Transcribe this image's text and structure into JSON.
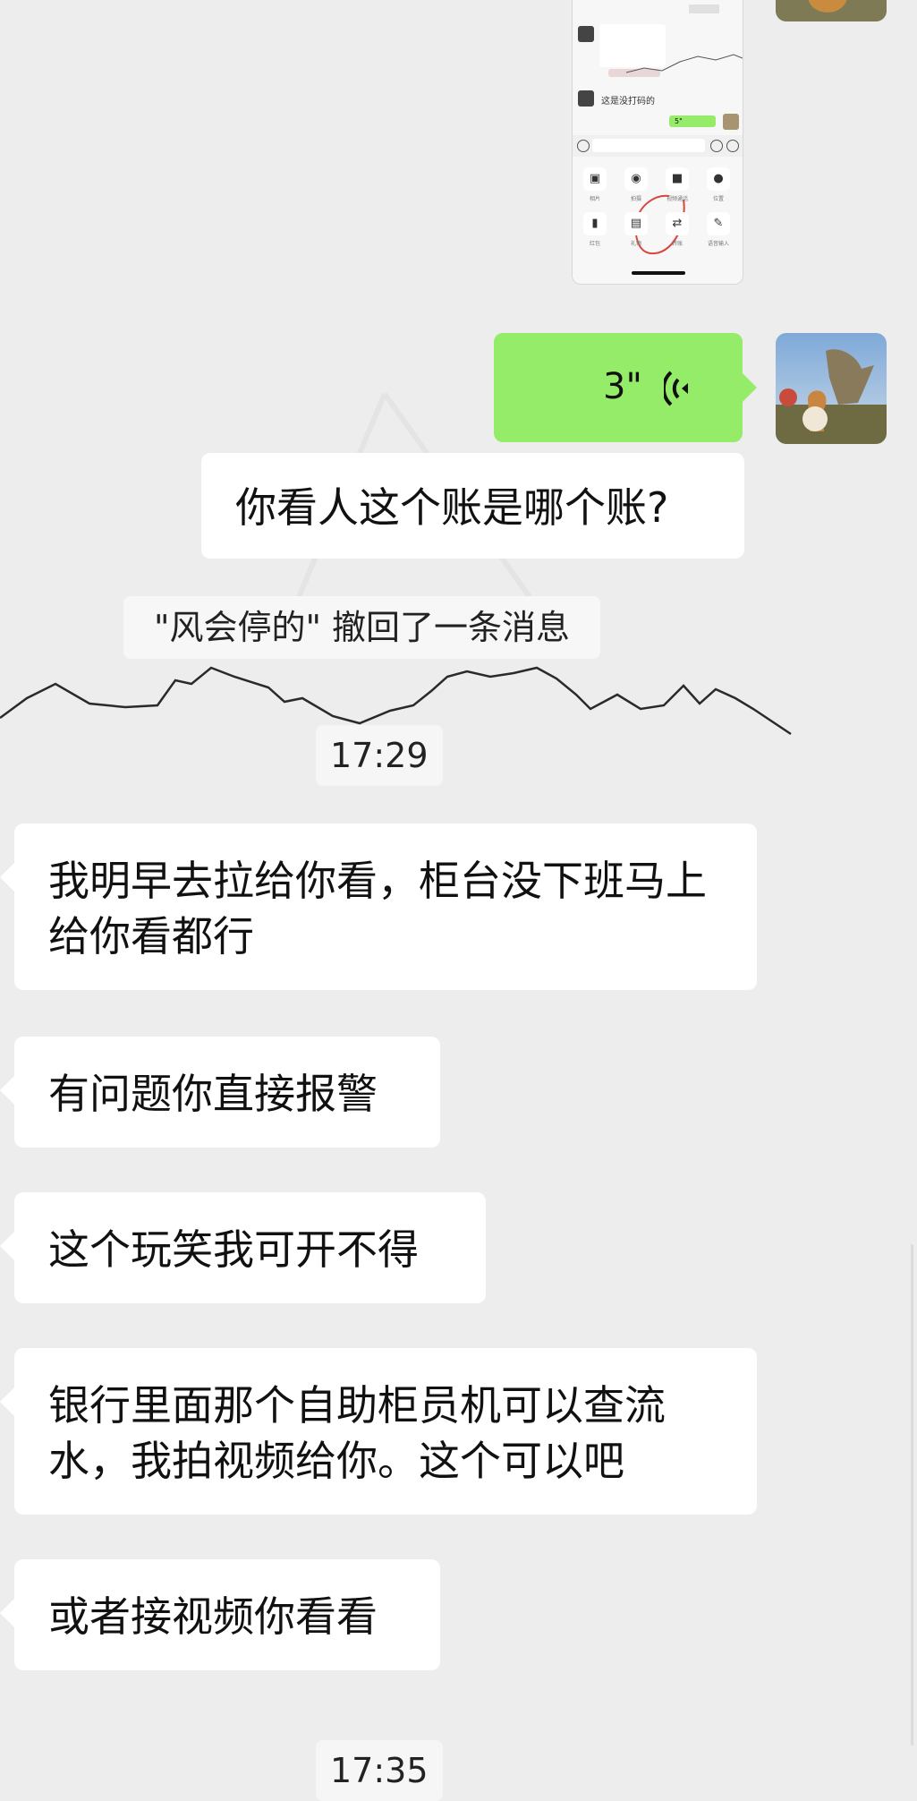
{
  "screenshot": {
    "line": "这是没打码的",
    "voice_duration": "5\"",
    "tools": [
      {
        "icon": "image-icon",
        "glyph": "▣",
        "label": "相片"
      },
      {
        "icon": "camera-icon",
        "glyph": "◉",
        "label": "拍摄"
      },
      {
        "icon": "video-call-icon",
        "glyph": "■",
        "label": "视频通话"
      },
      {
        "icon": "location-icon",
        "glyph": "●",
        "label": "位置"
      },
      {
        "icon": "red-packet-icon",
        "glyph": "▮",
        "label": "红包"
      },
      {
        "icon": "gift-icon",
        "glyph": "▤",
        "label": "礼物"
      },
      {
        "icon": "transfer-icon",
        "glyph": "⇄",
        "label": "转账"
      },
      {
        "icon": "voice-input-icon",
        "glyph": "✎",
        "label": "语音输入"
      }
    ],
    "highlight_color": "#d9453c"
  },
  "messages": {
    "voice": {
      "duration": "3\"",
      "icon": "voice-wave-icon"
    },
    "outgoing_question": "你看人这个账是哪个账?",
    "recall_notice": "\"风会停的\" 撤回了一条消息",
    "time_1": "17:29",
    "in_1": "我明早去拉给你看，柜台没下班马上给你看都行",
    "in_2": "有问题你直接报警",
    "in_3": "这个玩笑我可开不得",
    "in_4": "银行里面那个自助柜员机可以查流水，我拍视频给你。这个可以吧",
    "in_5": "或者接视频你看看",
    "time_2": "17:35"
  },
  "colors": {
    "background": "#ededed",
    "outgoing_bubble": "#95ec69",
    "incoming_bubble": "#ffffff"
  }
}
